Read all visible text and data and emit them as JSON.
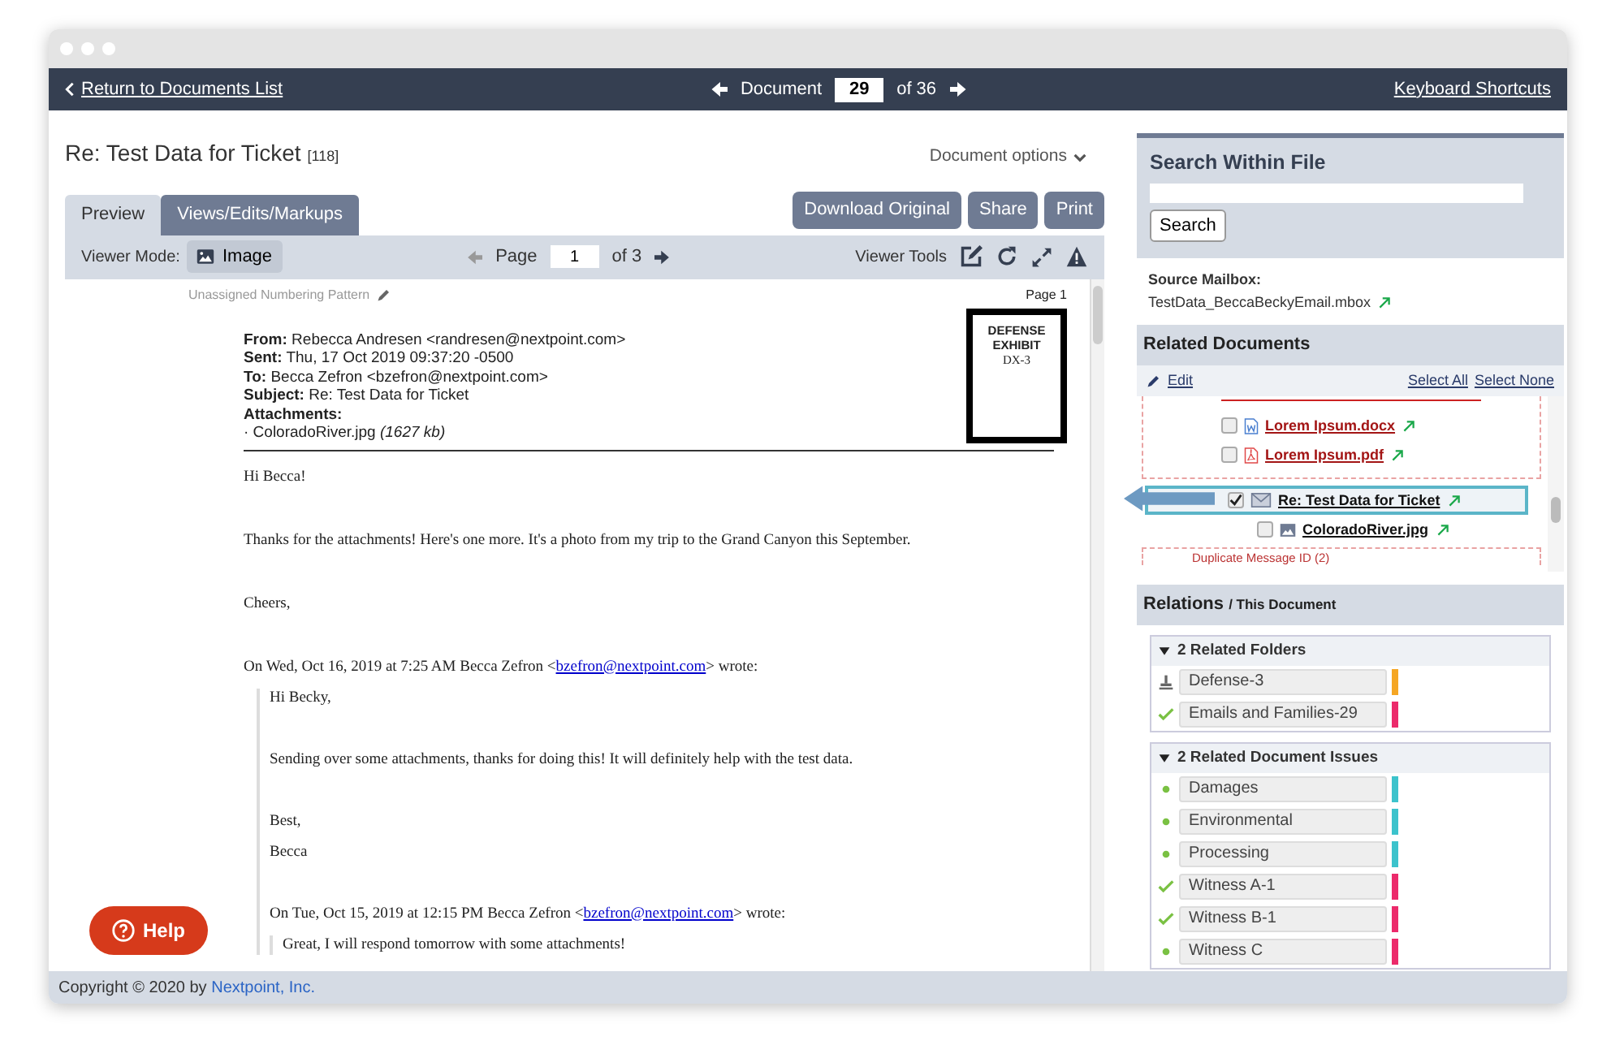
{
  "nav": {
    "back_link": "Return to Documents List",
    "document_label": "Document",
    "document_number": "29",
    "document_total": "of 36",
    "shortcuts_link": "Keyboard Shortcuts"
  },
  "document": {
    "title": "Re: Test Data for Ticket",
    "count": "[118]",
    "options": "Document options"
  },
  "tabs": [
    {
      "label": "Preview",
      "selected": true
    },
    {
      "label": "Views/Edits/Markups",
      "selected": false
    }
  ],
  "actions": [
    "Download Original",
    "Share",
    "Print"
  ],
  "viewer": {
    "mode_label": "Viewer Mode:",
    "mode": "Image",
    "page_label": "Page",
    "page": "1",
    "page_total": "of 3",
    "tools_label": "Viewer Tools"
  },
  "page": {
    "numbering": "Unassigned Numbering Pattern",
    "page_label": "Page 1",
    "stamp": [
      "DEFENSE",
      "EXHIBIT",
      "DX-3"
    ],
    "headers": [
      {
        "label": "From:",
        "value": "Rebecca Andresen <randresen@nextpoint.com>"
      },
      {
        "label": "Sent:",
        "value": "Thu, 17 Oct 2019 09:37:20 -0500"
      },
      {
        "label": "To:",
        "value": "Becca Zefron <bzefron@nextpoint.com>"
      },
      {
        "label": "Subject:",
        "value": "Re: Test Data for Ticket"
      }
    ],
    "attachments": {
      "label": "Attachments:",
      "items": [
        {
          "name": "· ColoradoRiver.jpg",
          "size": "(1627 kb)"
        }
      ]
    },
    "body": [
      {
        "kind": "para",
        "text": "Hi Becca!"
      },
      {
        "kind": "para",
        "text": "Thanks for the attachments! Here's one more. It's a photo from my trip to the Grand Canyon this September."
      },
      {
        "kind": "para",
        "text": "Cheers,"
      },
      {
        "kind": "reply",
        "before": "On Wed, Oct 16, 2019 at 7:25 AM Becca Zefron <",
        "link": "bzefron@nextpoint.com",
        "after": "> wrote:",
        "children": [
          {
            "kind": "para",
            "text": "Hi Becky,"
          },
          {
            "kind": "para",
            "text": "Sending over some attachments, thanks for doing this! It will definitely help with the test data."
          },
          {
            "kind": "line",
            "text": "Best,"
          },
          {
            "kind": "para",
            "text": "Becca"
          },
          {
            "kind": "reply",
            "before": "On Tue, Oct 15, 2019 at 12:15 PM Becca Zefron <",
            "link": "bzefron@nextpoint.com",
            "after": "> wrote:",
            "children": [
              {
                "kind": "para",
                "text": "Great, I will respond tomorrow with some attachments!"
              }
            ]
          }
        ]
      }
    ]
  },
  "search": {
    "title": "Search Within File",
    "button": "Search"
  },
  "source": {
    "label": "Source Mailbox:",
    "value": "TestData_BeccaBeckyEmail.mbox"
  },
  "related": {
    "title": "Related Documents",
    "edit": "Edit",
    "select_all": "Select All",
    "select_none": "Select None",
    "groups": [
      {
        "kind": "family",
        "items": [
          {
            "name": "Lorem Ipsum.docx",
            "kind": "docx",
            "checked": false,
            "selected": false
          },
          {
            "name": "Lorem Ipsum.pdf",
            "kind": "pdf",
            "checked": false,
            "selected": false
          }
        ]
      },
      {
        "kind": "plain",
        "items": [
          {
            "name": "Re: Test Data for Ticket",
            "kind": "email",
            "checked": true,
            "selected": true,
            "children": [
              {
                "name": "ColoradoRiver.jpg",
                "kind": "image",
                "checked": false,
                "selected": false
              }
            ]
          }
        ]
      },
      {
        "kind": "duplicates",
        "label": "Duplicate Message ID (2)"
      }
    ]
  },
  "relations": {
    "title": "Relations",
    "subtitle": "/ This Document",
    "sections": [
      {
        "title": "2 Related Folders",
        "expanded": true,
        "items": [
          {
            "kind": "stamp",
            "name": "Defense-3",
            "color": "#f5a623"
          },
          {
            "kind": "check",
            "name": "Emails and Families-29",
            "color": "#ec2a6b"
          }
        ]
      },
      {
        "title": "2 Related Document Issues",
        "expanded": true,
        "items": [
          {
            "kind": "dot",
            "name": "Damages",
            "color": "#3cc3cc"
          },
          {
            "kind": "dot",
            "name": "Environmental",
            "color": "#3cc3cc"
          },
          {
            "kind": "dot",
            "name": "Processing",
            "color": "#3cc3cc"
          },
          {
            "kind": "check",
            "name": "Witness A-1",
            "color": "#ec2a6b"
          },
          {
            "kind": "check",
            "name": "Witness B-1",
            "color": "#ec2a6b"
          },
          {
            "kind": "dot",
            "name": "Witness C",
            "color": "#ec2a6b"
          }
        ]
      }
    ]
  },
  "help": "Help",
  "footer": {
    "prefix": "Copyright © 2020 by",
    "link": "Nextpoint, Inc."
  }
}
